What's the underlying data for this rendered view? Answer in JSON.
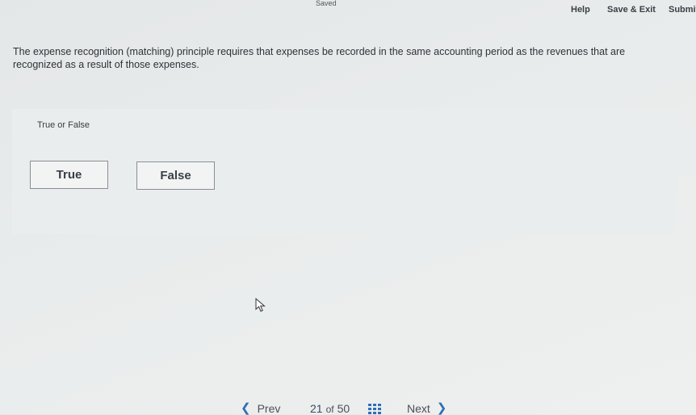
{
  "header": {
    "status": "Saved",
    "help_label": "Help",
    "save_exit_label": "Save & Exit",
    "submit_label": "Submit"
  },
  "question": {
    "text": "The expense recognition (matching) principle requires that expenses be recorded in the same accounting period as the revenues that are recognized as a result of those expenses."
  },
  "answer": {
    "type_label": "True or False",
    "options": [
      "True",
      "False"
    ]
  },
  "footer": {
    "prev_label": "Prev",
    "current_page": "21",
    "of_label": "of",
    "total_pages": "50",
    "next_label": "Next",
    "grid_icon": "grid-icon"
  },
  "colors": {
    "accent": "#2f6fb5",
    "border": "#8a8f96",
    "background": "#e9ecec"
  }
}
